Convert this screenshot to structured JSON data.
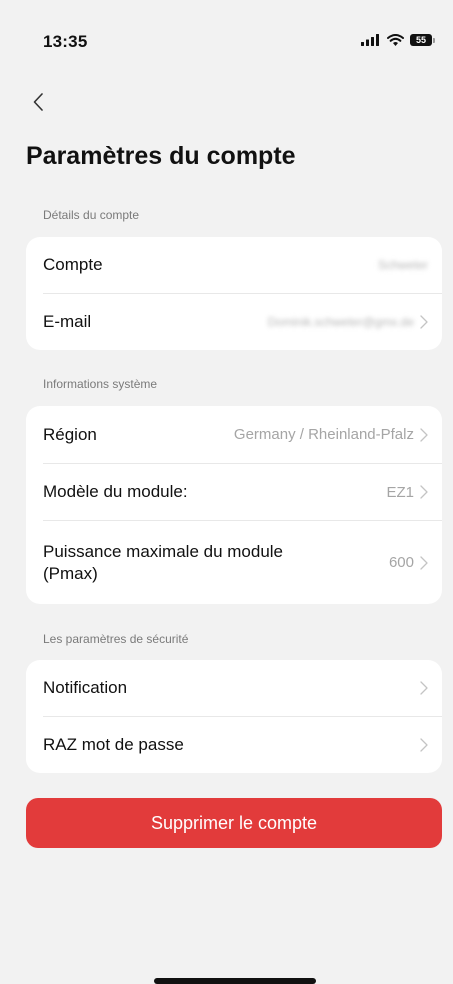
{
  "status_bar": {
    "time": "13:35",
    "battery": "55"
  },
  "header": {
    "title": "Paramètres du compte"
  },
  "sections": {
    "account": {
      "label": "Détails du compte",
      "rows": [
        {
          "label": "Compte",
          "value": "Schweter"
        },
        {
          "label": "E-mail",
          "value": "Dominik.schweter@gmx.de"
        }
      ]
    },
    "system": {
      "label": "Informations système",
      "rows": [
        {
          "label": "Région",
          "value": "Germany / Rheinland-Pfalz"
        },
        {
          "label": "Modèle du module:",
          "value": "EZ1"
        },
        {
          "label": "Puissance maximale du module (Pmax)",
          "value": "600"
        }
      ]
    },
    "security": {
      "label": "Les paramètres de sécurité",
      "rows": [
        {
          "label": "Notification",
          "value": ""
        },
        {
          "label": "RAZ mot de passe",
          "value": ""
        }
      ]
    }
  },
  "actions": {
    "delete_label": "Supprimer le compte"
  },
  "colors": {
    "background": "#f2f2f2",
    "card": "#ffffff",
    "danger": "#e23b3b",
    "secondary_text": "#a5a5a5"
  },
  "icons": {
    "back": "chevron-left-icon",
    "row_chevron": "chevron-right-icon",
    "signal": "cellular-signal-icon",
    "wifi": "wifi-icon",
    "battery": "battery-icon"
  }
}
